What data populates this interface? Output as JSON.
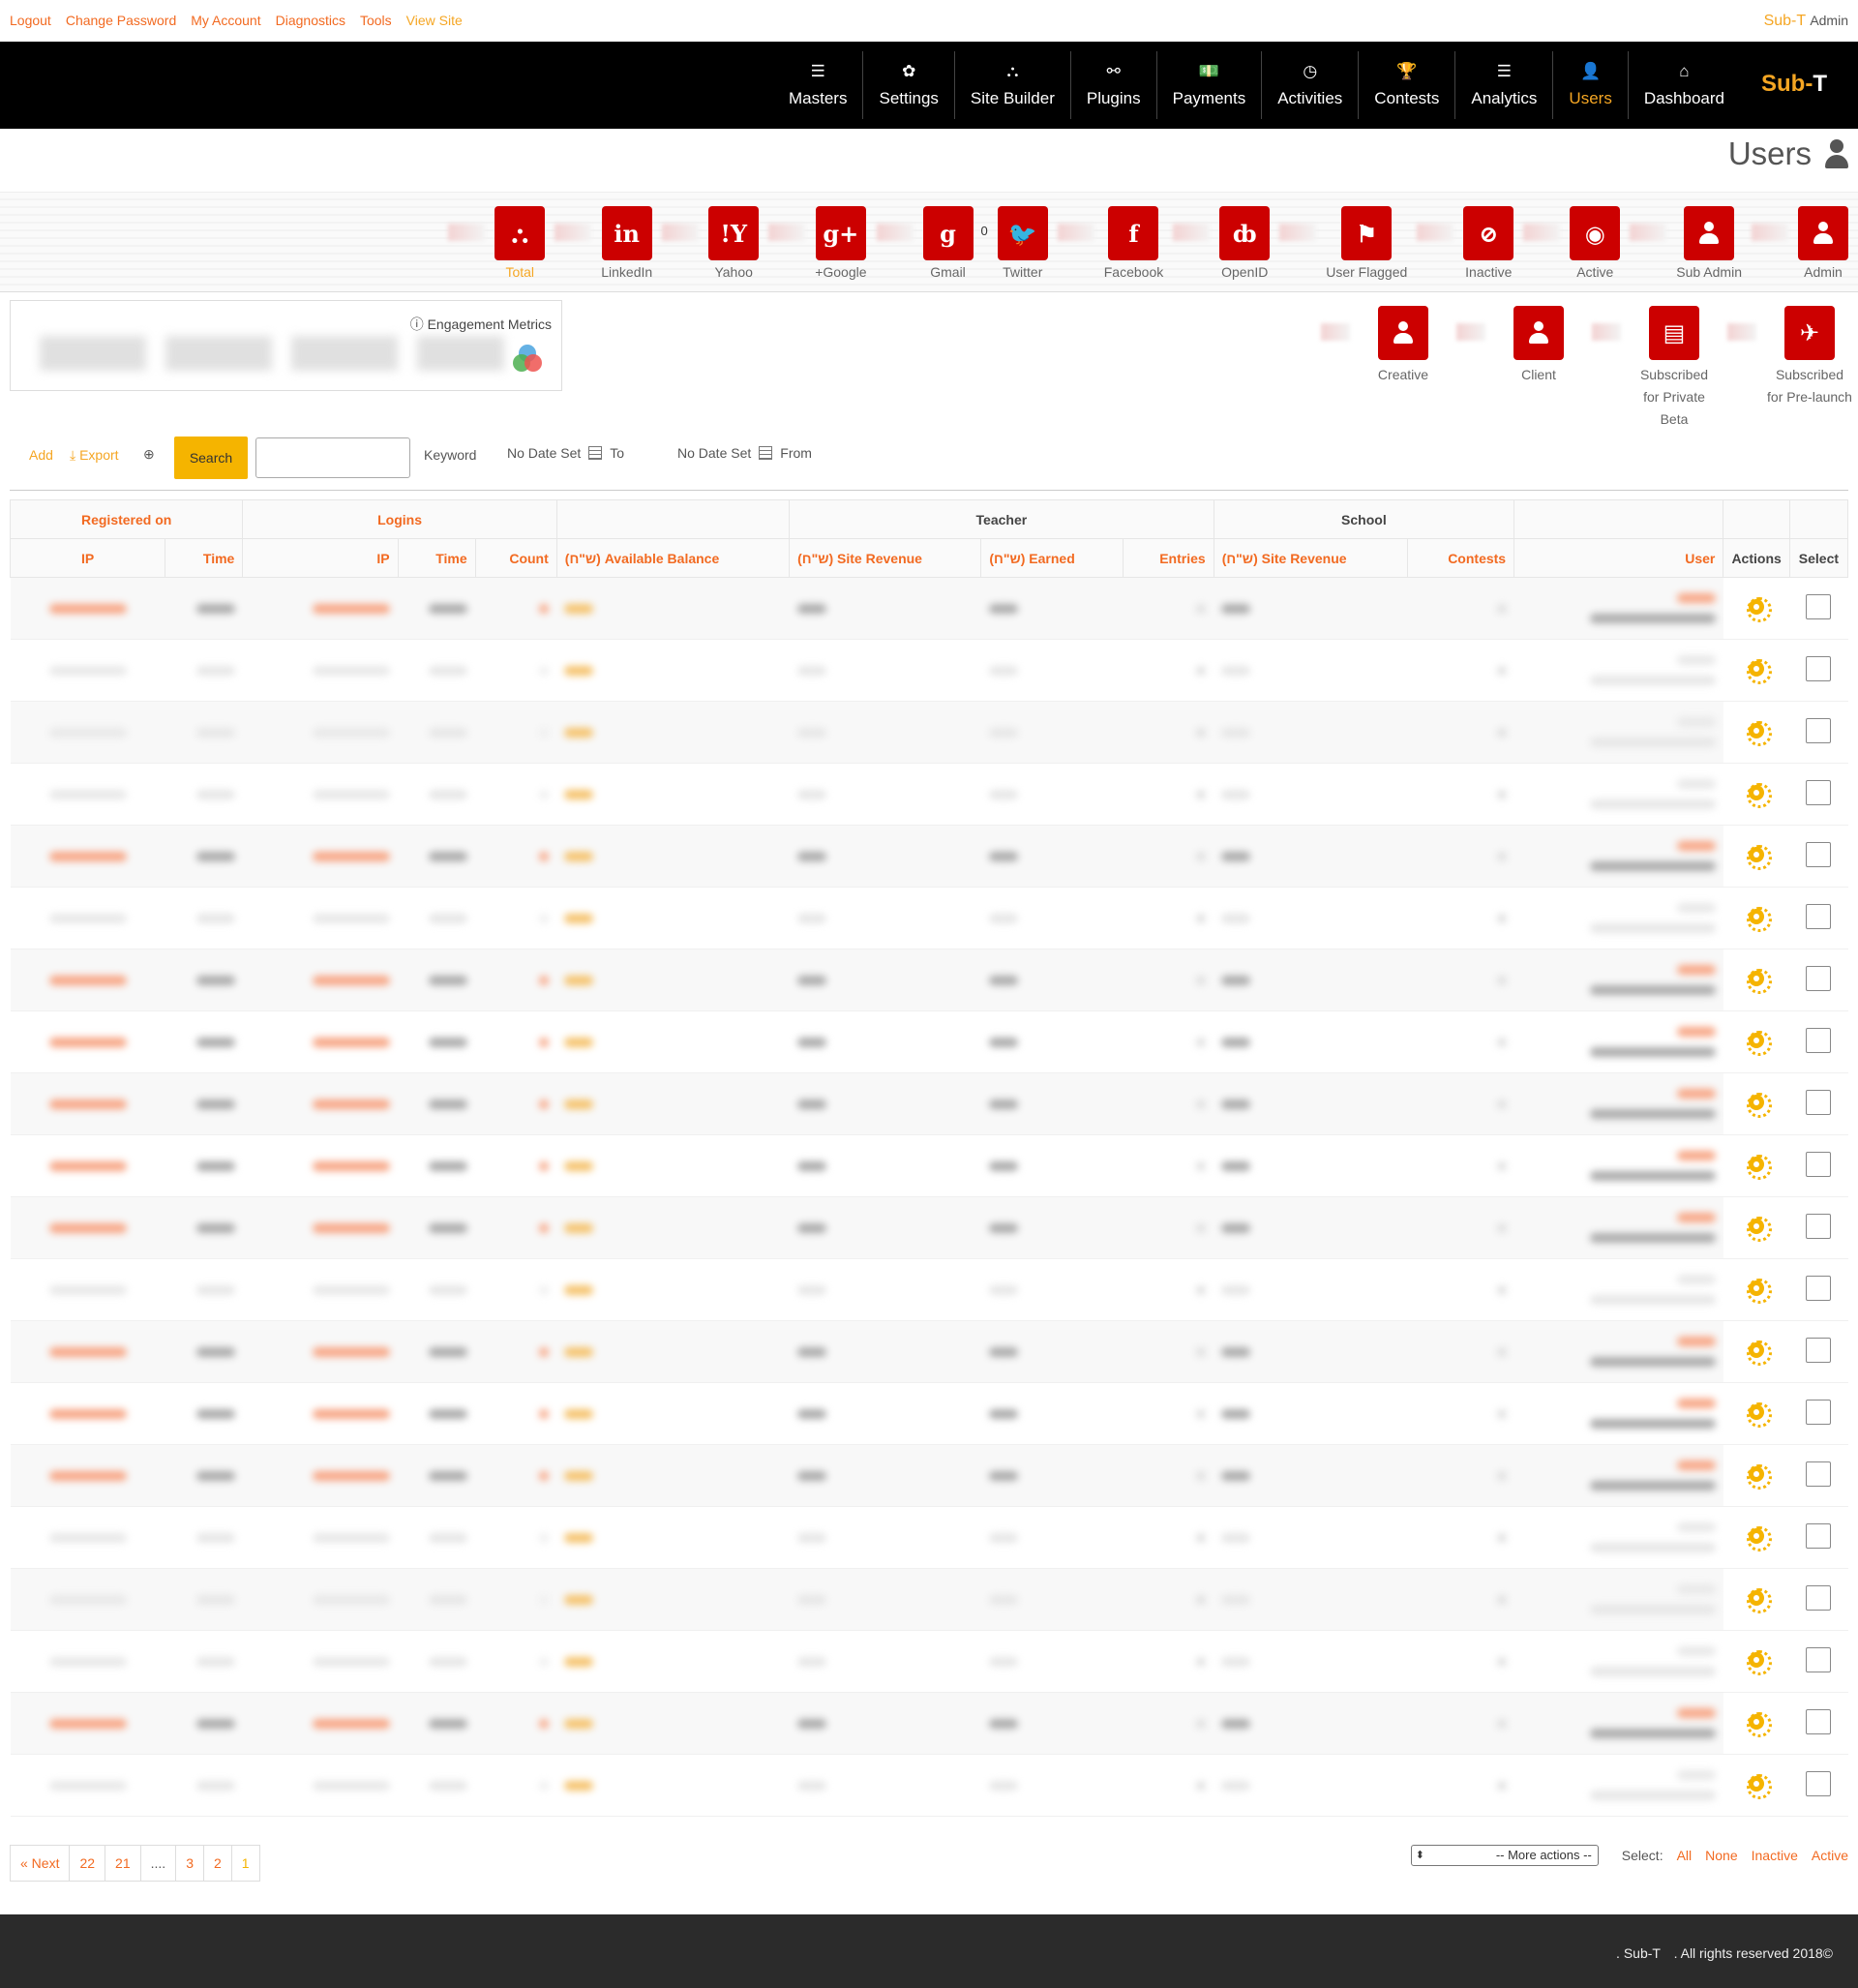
{
  "top": {
    "links": [
      "Logout",
      "Change Password",
      "My Account",
      "Diagnostics",
      "Tools"
    ],
    "view_site": "View Site",
    "brand": "Sub-T",
    "role": "Admin"
  },
  "nav": {
    "items": [
      {
        "label": "Masters",
        "icon": "☰"
      },
      {
        "label": "Settings",
        "icon": "✿"
      },
      {
        "label": "Site Builder",
        "icon": "⛬"
      },
      {
        "label": "Plugins",
        "icon": "⚯"
      },
      {
        "label": "Payments",
        "icon": "💵"
      },
      {
        "label": "Activities",
        "icon": "◷"
      },
      {
        "label": "Contests",
        "icon": "🏆"
      },
      {
        "label": "Analytics",
        "icon": "☰"
      },
      {
        "label": "Users",
        "icon": "👤"
      },
      {
        "label": "Dashboard",
        "icon": "⌂"
      }
    ],
    "logo_a": "Sub-",
    "logo_b": "T"
  },
  "page_title": "Users",
  "stats": [
    {
      "label": "Total",
      "glyph": "⛬"
    },
    {
      "label": "LinkedIn",
      "glyph": "in"
    },
    {
      "label": "Yahoo",
      "glyph": "!Y"
    },
    {
      "label": "+Google",
      "glyph": "g+"
    },
    {
      "label": "Gmail",
      "glyph": "g"
    },
    {
      "label": "Twitter",
      "glyph": "🐦"
    },
    {
      "label": "Facebook",
      "glyph": "f"
    },
    {
      "label": "OpenID",
      "glyph": "ȸ"
    },
    {
      "label": "User Flagged",
      "glyph": "⚑"
    },
    {
      "label": "Inactive",
      "glyph": "⊘"
    },
    {
      "label": "Active",
      "glyph": "◉"
    },
    {
      "label": "Sub Admin",
      "glyph": ""
    },
    {
      "label": "Admin",
      "glyph": ""
    }
  ],
  "gmail_count": "0",
  "stats2": [
    {
      "label": "Creative"
    },
    {
      "label": "Client"
    },
    {
      "label": "Subscribed for Private Beta"
    },
    {
      "label": "Subscribed for Pre-launch"
    }
  ],
  "engagement": {
    "title": "Engagement Metrics"
  },
  "toolbar": {
    "add": "Add",
    "export": "Export",
    "search": "Search",
    "keyword": "Keyword",
    "date_to": "No Date Set",
    "to": "To",
    "date_from": "No Date Set",
    "from": "From"
  },
  "table": {
    "group_headers": {
      "registered": "Registered on",
      "logins": "Logins",
      "teacher": "Teacher",
      "school": "School"
    },
    "columns": {
      "reg_ip": "IP",
      "reg_time": "Time",
      "log_ip": "IP",
      "log_time": "Time",
      "count": "Count",
      "balance": "(ש\"ח) Available Balance",
      "t_revenue": "(ש\"ח) Site Revenue",
      "t_earned": "(ש\"ח) Earned",
      "t_entries": "Entries",
      "s_revenue": "(ש\"ח) Site Revenue",
      "s_contests": "Contests",
      "user": "User",
      "actions": "Actions",
      "select": "Select"
    },
    "row_count": 20
  },
  "pagination": [
    "« Next",
    "22",
    "21",
    "....",
    "3",
    "2",
    "1"
  ],
  "bulk": {
    "more_actions": "-- More actions --",
    "select_label": "Select:",
    "options": [
      "All",
      "None",
      "Inactive",
      "Active"
    ]
  },
  "footer": {
    "brand": ". Sub-T",
    "rights": ". All rights reserved 2018©"
  },
  "colors": {
    "accent": "#f26a21",
    "brand": "#f5a623",
    "stat_box": "#cc0000",
    "nav_bg": "#000000"
  }
}
